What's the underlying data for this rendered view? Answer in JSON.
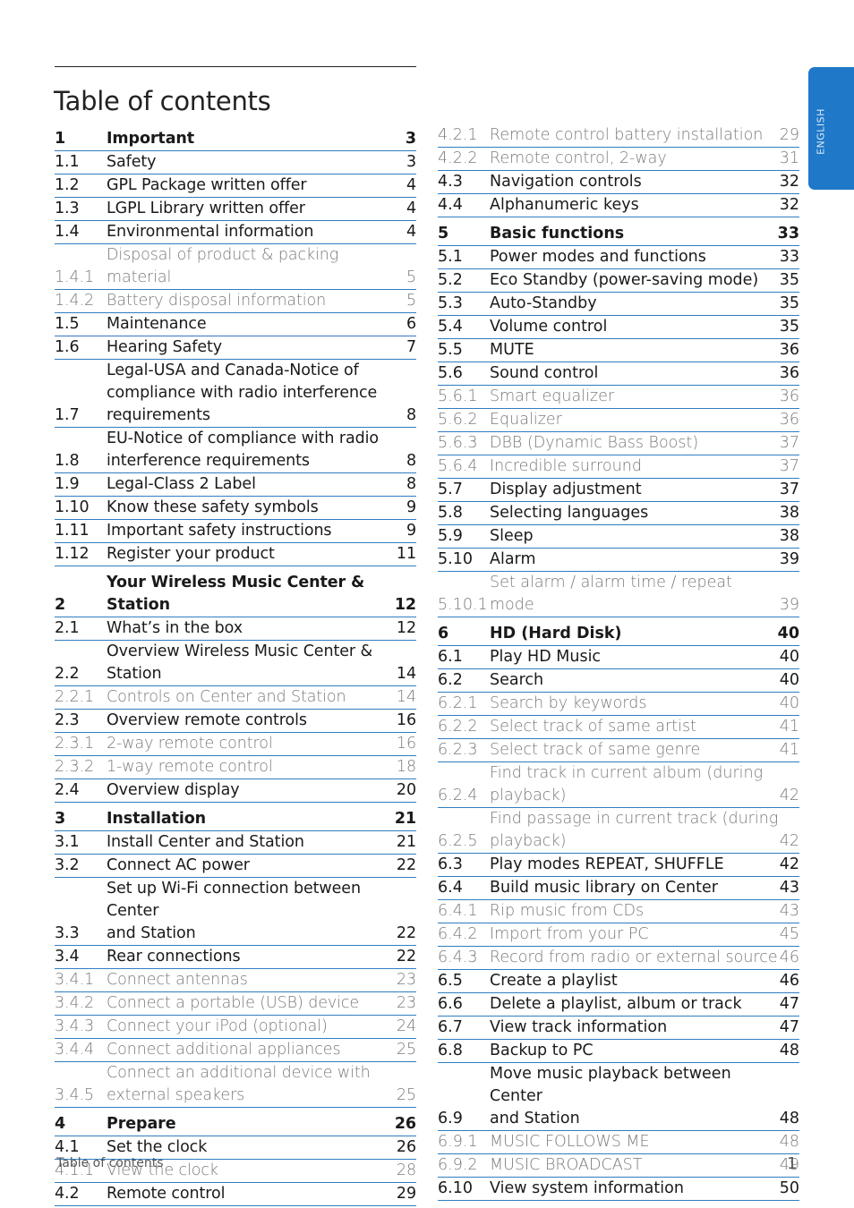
{
  "page": {
    "title": "Table of contents",
    "language_tab": "ENGLISH",
    "footer_label": "Table of contents",
    "page_number": "1",
    "accent_color": "#1f78c8"
  },
  "toc": {
    "left": [
      {
        "num": "1",
        "lines": [
          "Important"
        ],
        "page": "3",
        "level": "chapter"
      },
      {
        "num": "1.1",
        "lines": [
          "Safety"
        ],
        "page": "3",
        "level": "section"
      },
      {
        "num": "1.2",
        "lines": [
          "GPL Package written offer"
        ],
        "page": "4",
        "level": "section"
      },
      {
        "num": "1.3",
        "lines": [
          "LGPL Library written offer"
        ],
        "page": "4",
        "level": "section"
      },
      {
        "num": "1.4",
        "lines": [
          "Environmental information"
        ],
        "page": "4",
        "level": "section"
      },
      {
        "num": "1.4.1",
        "lines": [
          "Disposal of product & packing material"
        ],
        "page": "5",
        "level": "sub"
      },
      {
        "num": "1.4.2",
        "lines": [
          "Battery disposal information"
        ],
        "page": "5",
        "level": "sub"
      },
      {
        "num": "1.5",
        "lines": [
          "Maintenance"
        ],
        "page": "6",
        "level": "section"
      },
      {
        "num": "1.6",
        "lines": [
          "Hearing Safety"
        ],
        "page": "7",
        "level": "section"
      },
      {
        "num": "1.7",
        "lines": [
          "Legal-USA and Canada-Notice of",
          "compliance with radio interference",
          "requirements"
        ],
        "page": "8",
        "level": "section"
      },
      {
        "num": "1.8",
        "lines": [
          "EU-Notice of compliance with radio",
          "interference requirements"
        ],
        "page": "8",
        "level": "section"
      },
      {
        "num": "1.9",
        "lines": [
          "Legal-Class 2 Label"
        ],
        "page": "8",
        "level": "section"
      },
      {
        "num": "1.10",
        "lines": [
          "Know these safety symbols"
        ],
        "page": "9",
        "level": "section"
      },
      {
        "num": "1.11",
        "lines": [
          "Important safety instructions"
        ],
        "page": "9",
        "level": "section"
      },
      {
        "num": "1.12",
        "lines": [
          "Register your product"
        ],
        "page": "11",
        "level": "section"
      },
      {
        "num": "2",
        "lines": [
          "Your Wireless Music Center &",
          "Station"
        ],
        "page": "12",
        "level": "chapter"
      },
      {
        "num": "2.1",
        "lines": [
          "What’s in the box"
        ],
        "page": "12",
        "level": "section"
      },
      {
        "num": "2.2",
        "lines": [
          "Overview Wireless Music Center &",
          "Station"
        ],
        "page": "14",
        "level": "section"
      },
      {
        "num": "2.2.1",
        "lines": [
          "Controls on Center  and Station"
        ],
        "page": "14",
        "level": "sub"
      },
      {
        "num": "2.3",
        "lines": [
          "Overview remote controls"
        ],
        "page": "16",
        "level": "section"
      },
      {
        "num": "2.3.1",
        "lines": [
          "2-way remote control"
        ],
        "page": "16",
        "level": "sub"
      },
      {
        "num": "2.3.2",
        "lines": [
          "1-way remote control"
        ],
        "page": "18",
        "level": "sub"
      },
      {
        "num": "2.4",
        "lines": [
          "Overview display"
        ],
        "page": "20",
        "level": "section"
      },
      {
        "num": "3",
        "lines": [
          "Installation"
        ],
        "page": "21",
        "level": "chapter"
      },
      {
        "num": "3.1",
        "lines": [
          "Install Center and Station"
        ],
        "page": "21",
        "level": "section"
      },
      {
        "num": "3.2",
        "lines": [
          "Connect AC power"
        ],
        "page": "22",
        "level": "section"
      },
      {
        "num": "3.3",
        "lines": [
          "Set up Wi-Fi connection between Center",
          "and Station"
        ],
        "page": "22",
        "level": "section"
      },
      {
        "num": "3.4",
        "lines": [
          "Rear connections"
        ],
        "page": "22",
        "level": "section"
      },
      {
        "num": "3.4.1",
        "lines": [
          "Connect antennas"
        ],
        "page": "23",
        "level": "sub"
      },
      {
        "num": "3.4.2",
        "lines": [
          "Connect a portable (USB) device"
        ],
        "page": "23",
        "level": "sub"
      },
      {
        "num": "3.4.3",
        "lines": [
          "Connect your iPod (optional)"
        ],
        "page": "24",
        "level": "sub"
      },
      {
        "num": "3.4.4",
        "lines": [
          "Connect additional appliances"
        ],
        "page": "25",
        "level": "sub"
      },
      {
        "num": "3.4.5",
        "lines": [
          "Connect an additional device with",
          "external speakers"
        ],
        "page": "25",
        "level": "sub"
      },
      {
        "num": "4",
        "lines": [
          "Prepare"
        ],
        "page": "26",
        "level": "chapter"
      },
      {
        "num": "4.1",
        "lines": [
          "Set the clock"
        ],
        "page": "26",
        "level": "section"
      },
      {
        "num": "4.1.1",
        "lines": [
          "View the clock"
        ],
        "page": "28",
        "level": "sub"
      },
      {
        "num": "4.2",
        "lines": [
          "Remote control"
        ],
        "page": "29",
        "level": "section"
      }
    ],
    "right": [
      {
        "num": "4.2.1",
        "lines": [
          "Remote control battery installation"
        ],
        "page": "29",
        "level": "sub"
      },
      {
        "num": "4.2.2",
        "lines": [
          "Remote control, 2-way"
        ],
        "page": "31",
        "level": "sub"
      },
      {
        "num": "4.3",
        "lines": [
          "Navigation controls"
        ],
        "page": "32",
        "level": "section"
      },
      {
        "num": "4.4",
        "lines": [
          "Alphanumeric keys"
        ],
        "page": "32",
        "level": "section"
      },
      {
        "num": "5",
        "lines": [
          "Basic functions"
        ],
        "page": "33",
        "level": "chapter"
      },
      {
        "num": "5.1",
        "lines": [
          "Power modes and functions"
        ],
        "page": "33",
        "level": "section"
      },
      {
        "num": "5.2",
        "lines": [
          "Eco Standby (power-saving mode)"
        ],
        "page": "35",
        "level": "section"
      },
      {
        "num": "5.3",
        "lines": [
          "Auto-Standby"
        ],
        "page": "35",
        "level": "section"
      },
      {
        "num": "5.4",
        "lines": [
          "Volume control"
        ],
        "page": "35",
        "level": "section"
      },
      {
        "num": "5.5",
        "lines": [
          "MUTE"
        ],
        "page": "36",
        "level": "section"
      },
      {
        "num": "5.6",
        "lines": [
          "Sound control"
        ],
        "page": "36",
        "level": "section"
      },
      {
        "num": "5.6.1",
        "lines": [
          "Smart equalizer"
        ],
        "page": "36",
        "level": "sub"
      },
      {
        "num": "5.6.2",
        "lines": [
          "Equalizer"
        ],
        "page": "36",
        "level": "sub"
      },
      {
        "num": "5.6.3",
        "lines": [
          "DBB (Dynamic Bass Boost)"
        ],
        "page": "37",
        "level": "sub"
      },
      {
        "num": "5.6.4",
        "lines": [
          "Incredible surround"
        ],
        "page": "37",
        "level": "sub"
      },
      {
        "num": "5.7",
        "lines": [
          "Display adjustment"
        ],
        "page": "37",
        "level": "section"
      },
      {
        "num": "5.8",
        "lines": [
          "Selecting languages"
        ],
        "page": "38",
        "level": "section"
      },
      {
        "num": "5.9",
        "lines": [
          "Sleep"
        ],
        "page": "38",
        "level": "section"
      },
      {
        "num": "5.10",
        "lines": [
          "Alarm"
        ],
        "page": "39",
        "level": "section"
      },
      {
        "num": "5.10.1",
        "lines": [
          "Set alarm / alarm time / repeat mode"
        ],
        "page": "39",
        "level": "sub"
      },
      {
        "num": "6",
        "lines": [
          "HD (Hard Disk)"
        ],
        "page": "40",
        "level": "chapter"
      },
      {
        "num": "6.1",
        "lines": [
          "Play HD Music"
        ],
        "page": "40",
        "level": "section"
      },
      {
        "num": "6.2",
        "lines": [
          "Search"
        ],
        "page": "40",
        "level": "section"
      },
      {
        "num": "6.2.1",
        "lines": [
          "Search by keywords"
        ],
        "page": "40",
        "level": "sub"
      },
      {
        "num": "6.2.2",
        "lines": [
          "Select track of same artist"
        ],
        "page": "41",
        "level": "sub"
      },
      {
        "num": "6.2.3",
        "lines": [
          "Select track of same genre"
        ],
        "page": "41",
        "level": "sub"
      },
      {
        "num": "6.2.4",
        "lines": [
          "Find track in current album (during",
          "playback)"
        ],
        "page": "42",
        "level": "sub"
      },
      {
        "num": "6.2.5",
        "lines": [
          "Find passage in current track (during",
          "playback)"
        ],
        "page": "42",
        "level": "sub"
      },
      {
        "num": "6.3",
        "lines": [
          "Play modes REPEAT, SHUFFLE"
        ],
        "page": "42",
        "level": "section"
      },
      {
        "num": "6.4",
        "lines": [
          "Build music library on Center"
        ],
        "page": "43",
        "level": "section"
      },
      {
        "num": "6.4.1",
        "lines": [
          "Rip music from CDs"
        ],
        "page": "43",
        "level": "sub"
      },
      {
        "num": "6.4.2",
        "lines": [
          "Import from your PC"
        ],
        "page": "45",
        "level": "sub"
      },
      {
        "num": "6.4.3",
        "lines": [
          "Record from radio or external source"
        ],
        "page": "46",
        "level": "sub"
      },
      {
        "num": "6.5",
        "lines": [
          "Create a playlist"
        ],
        "page": "46",
        "level": "section"
      },
      {
        "num": "6.6",
        "lines": [
          "Delete a playlist, album or track"
        ],
        "page": "47",
        "level": "section"
      },
      {
        "num": "6.7",
        "lines": [
          "View track information"
        ],
        "page": "47",
        "level": "section"
      },
      {
        "num": "6.8",
        "lines": [
          "Backup to PC"
        ],
        "page": "48",
        "level": "section"
      },
      {
        "num": "6.9",
        "lines": [
          "Move music playback between Center",
          "and Station"
        ],
        "page": "48",
        "level": "section"
      },
      {
        "num": "6.9.1",
        "lines": [
          "MUSIC FOLLOWS ME"
        ],
        "page": "48",
        "level": "sub"
      },
      {
        "num": "6.9.2",
        "lines": [
          "MUSIC BROADCAST"
        ],
        "page": "49",
        "level": "sub"
      },
      {
        "num": "6.10",
        "lines": [
          "View system information"
        ],
        "page": "50",
        "level": "section"
      }
    ]
  }
}
